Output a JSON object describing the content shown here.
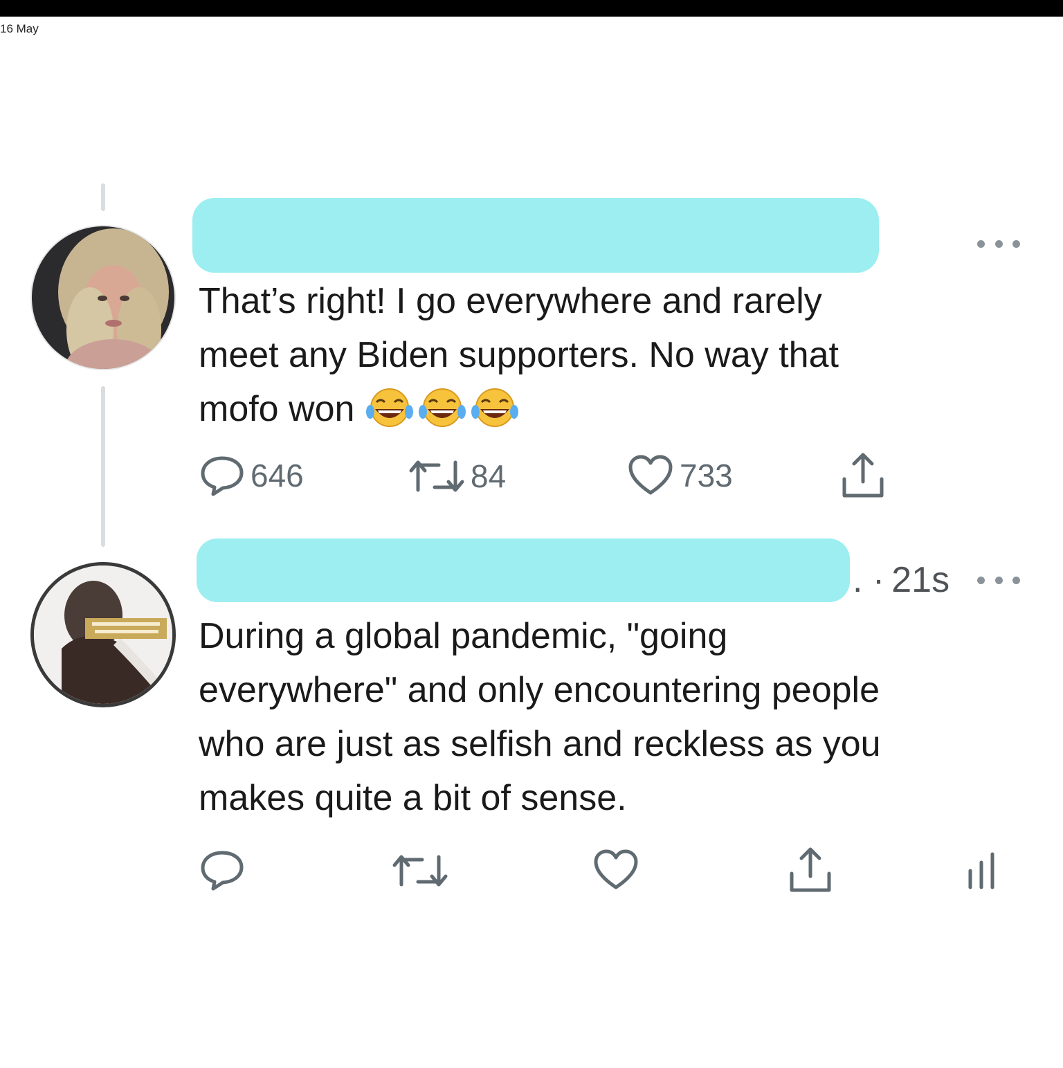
{
  "status_bar": {
    "date": "16 May"
  },
  "tweets": [
    {
      "text_lines": [
        "That’s right! I go everywhere and rarely",
        "meet any Biden supporters. No way that",
        "mofo won"
      ],
      "emojis": [
        "face-with-tears-of-joy",
        "face-with-tears-of-joy",
        "face-with-tears-of-joy"
      ],
      "actions": {
        "reply_count": "646",
        "retweet_count": "84",
        "like_count": "733"
      }
    },
    {
      "timestamp_prefix": ".",
      "timestamp_dot": "·",
      "timestamp": "21s",
      "text_lines": [
        "During a global pandemic, \"going",
        "everywhere\" and only encountering people",
        "who are just as selfish and reckless as you",
        "makes quite a bit of sense."
      ]
    }
  ],
  "colors": {
    "redaction": "#9ceef0",
    "icon_gray": "#606a71",
    "thread_line": "#d9dde0"
  }
}
